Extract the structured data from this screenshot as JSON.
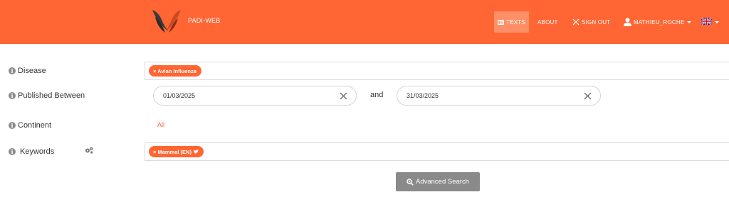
{
  "header": {
    "brand": "PADI-WEB",
    "nav": {
      "texts": "TEXTS",
      "about": "ABOUT",
      "sign_out": "SIGN OUT",
      "user": "MATHIEU_ROCHE"
    },
    "colors": {
      "bar": "#ff6633",
      "active": "#ff8f66"
    }
  },
  "filters": {
    "disease": {
      "label": "Disease",
      "tags": [
        "× Avian Influenza"
      ]
    },
    "published_between": {
      "label": "Published Between",
      "from": "01/03/2025",
      "and_label": "and",
      "to": "31/03/2025"
    },
    "continent": {
      "label": "Continent",
      "value": "All"
    },
    "keywords": {
      "label": "Keywords",
      "tags": [
        "× Mammal (EN)"
      ]
    }
  },
  "actions": {
    "advanced_search": "Advanced Search"
  },
  "icons": [
    "logo-bird-icon",
    "texts-icon",
    "close-icon",
    "user-icon",
    "uk-flag-icon",
    "info-icon",
    "gears-icon",
    "twitter-icon",
    "search-icon"
  ]
}
